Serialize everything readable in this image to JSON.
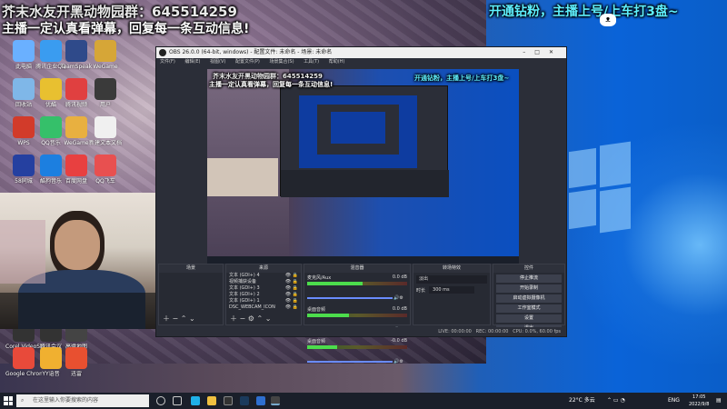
{
  "overlay": {
    "group_line": "芥末水友开黑动物园群：645514259",
    "notice_line": "主播一定认真看弹幕，回复每一条互动信息!",
    "right_banner": "开通钻粉，主播上号/上车打3盘~"
  },
  "desktop_icons": [
    {
      "label": "此电脑",
      "color": "#6ab0ff"
    },
    {
      "label": "腾讯企业QQ",
      "color": "#3a9cf0"
    },
    {
      "label": "TeamSpeak",
      "color": "#2f4a8a"
    },
    {
      "label": "WeGame",
      "color": "#d6a637"
    },
    {
      "label": "回收站",
      "color": "#7fb7e8"
    },
    {
      "label": "优酷",
      "color": "#e8c030"
    },
    {
      "label": "腾讯视频",
      "color": "#e04040"
    },
    {
      "label": "用户",
      "color": "#3a3a3a"
    },
    {
      "label": "WPS",
      "color": "#d23b2a"
    },
    {
      "label": "QQ音乐",
      "color": "#35c06a"
    },
    {
      "label": "WeGame",
      "color": "#e8b040"
    },
    {
      "label": "新建文本文档",
      "color": "#f0f0f0"
    },
    {
      "label": "58同城",
      "color": "#2540a0"
    },
    {
      "label": "酷狗音乐",
      "color": "#1c7fe0"
    },
    {
      "label": "百度网盘",
      "color": "#e84040"
    },
    {
      "label": "QQ飞车",
      "color": "#e85050"
    },
    {
      "label": "Corel VideoStudio",
      "color": "#333333"
    },
    {
      "label": "腾讯会议",
      "color": "#333333"
    },
    {
      "label": "高德地图",
      "color": "#444444"
    },
    {
      "label": "Google Chrome",
      "color": "#e84a3a"
    },
    {
      "label": "YY语音",
      "color": "#f0b030"
    },
    {
      "label": "迅雷",
      "color": "#e85030"
    }
  ],
  "obs": {
    "title": "OBS 26.0.0 (64-bit, windows) - 配置文件: 未命名 - 场景: 未命名",
    "menu": [
      "文件(F)",
      "编辑(E)",
      "视图(V)",
      "配置文件(P)",
      "场景集合(S)",
      "工具(T)",
      "帮助(H)"
    ],
    "scenes_header": "场景",
    "sources_header": "来源",
    "mixer_header": "混音器",
    "transitions_header": "转场特效",
    "controls_header": "控件",
    "sources": [
      "文本 (GDI+) 4",
      "视频捕获设备",
      "文本 (GDI+) 3",
      "文本 (GDI+) 2",
      "文本 (GDI+) 1",
      "DSC_WEBCAM_ICON"
    ],
    "mixer": [
      {
        "name": "麦克风/Aux",
        "db": "0.0 dB",
        "level": 0.55
      },
      {
        "name": "桌面音频",
        "db": "0.0 dB",
        "level": 0.42
      },
      {
        "name": "桌面音频",
        "db": "-0.0 dB",
        "level": 0.3
      }
    ],
    "transition_value": "淡出",
    "duration_label": "时长",
    "duration_value": "300 ms",
    "controls": [
      "停止推流",
      "开始录制",
      "启动虚拟摄像机",
      "工作室模式",
      "设置",
      "退出"
    ],
    "status": {
      "live": "LIVE: 00:00:00",
      "rec": "REC: 00:00:00",
      "cpu": "CPU: 0.0%, 60.00 fps"
    }
  },
  "taskbar": {
    "search_placeholder": "在这里输入你要搜索的内容",
    "weather": "22°C 多云",
    "ime": "ENG",
    "time": "17:05",
    "date": "2022/9/8"
  }
}
